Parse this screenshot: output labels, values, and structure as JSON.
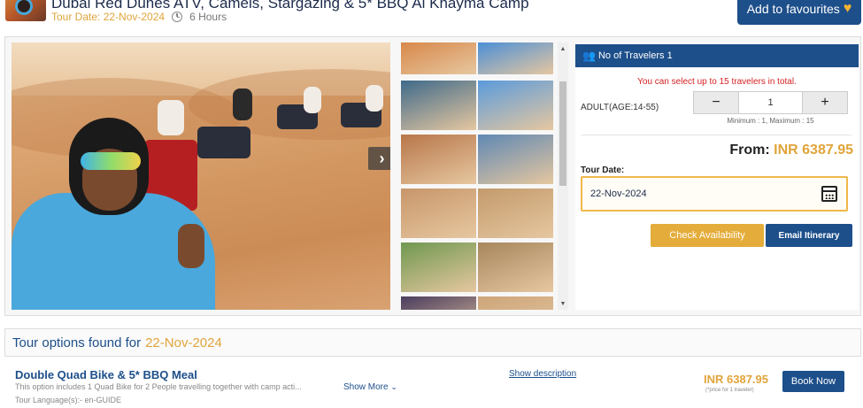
{
  "header": {
    "title": "Dubai Red Dunes ATV, Camels, Stargazing & 5* BBQ Al Khayma Camp",
    "tour_date": "Tour Date: 22-Nov-2024",
    "duration": "6 Hours",
    "favourite_label": "Add to favourites"
  },
  "gallery": {
    "next_glyph": "›",
    "thumbnail_colors": [
      "#d8884a",
      "#4c8fd6",
      "#3f6a8a",
      "#5a9bdc",
      "#b8764a",
      "#5f88b4",
      "#c8966a",
      "#c39a6c",
      "#6f9850",
      "#a7865d",
      "#4b3d5e",
      "#cda57a"
    ]
  },
  "booking": {
    "travelers_header": "No of Travelers 1",
    "limit_message": "You can select up to 15 travelers in total.",
    "adult_label": "ADULT(AGE:14-55)",
    "minus": "−",
    "plus": "+",
    "adult_count": "1",
    "min_max": "Minimum : 1, Maximum : 15",
    "price_prefix": "From:",
    "price": "INR 6387.95",
    "date_label": "Tour Date:",
    "date_value": "22-Nov-2024",
    "check_label": "Check Availability",
    "email_label": "Email Itinerary"
  },
  "options": {
    "heading": "Tour options found for",
    "heading_date": "22-Nov-2024",
    "items": [
      {
        "title": "Double Quad Bike & 5* BBQ Meal",
        "description": "This option includes 1 Quad Bike for 2 People travelling together with camp acti...",
        "show_more": "Show More",
        "language": "Tour Language(s):- en-GUIDE",
        "show_description": "Show description",
        "price": "INR 6387.95",
        "price_note": "(*price for 1 traveler)",
        "book_label": "Book Now"
      }
    ]
  }
}
